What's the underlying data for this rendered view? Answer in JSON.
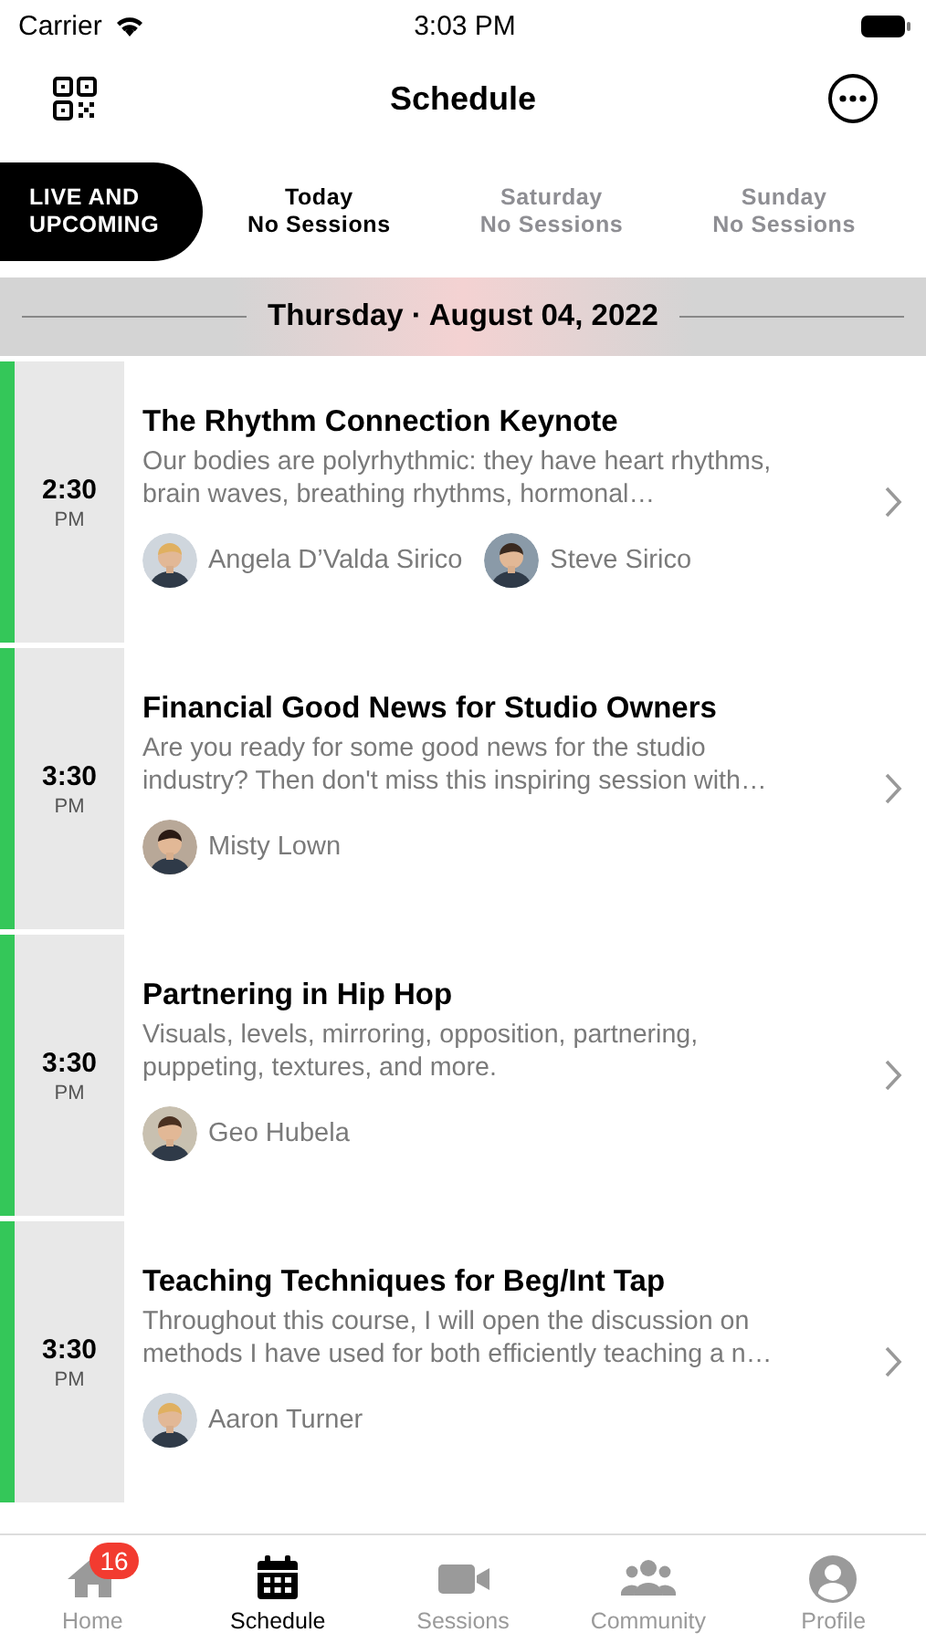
{
  "status_bar": {
    "carrier": "Carrier",
    "time": "3:03 PM"
  },
  "nav": {
    "title": "Schedule"
  },
  "day_tabs": [
    {
      "kind": "pill",
      "label": "LIVE AND UPCOMING",
      "selected": true,
      "disabled": false
    },
    {
      "kind": "day",
      "label": "Today",
      "sub": "No Sessions",
      "selected": false,
      "disabled": false
    },
    {
      "kind": "day",
      "label": "Saturday",
      "sub": "No Sessions",
      "selected": false,
      "disabled": true
    },
    {
      "kind": "day",
      "label": "Sunday",
      "sub": "No Sessions",
      "selected": false,
      "disabled": true
    }
  ],
  "date_header": "Thursday · August 04, 2022",
  "sessions": [
    {
      "time": "2:30",
      "period": "PM",
      "color": "#34c759",
      "title": "The Rhythm Connection Keynote",
      "description": "Our bodies are polyrhythmic: they have heart rhythms, brain waves, breathing rhythms, hormonal…",
      "speakers": [
        {
          "name": "Angela D’Valda Sirico"
        },
        {
          "name": "Steve Sirico"
        }
      ]
    },
    {
      "time": "3:30",
      "period": "PM",
      "color": "#34c759",
      "title": "Financial Good News for Studio Owners",
      "description": "Are you ready for some good news for the studio industry? Then don't miss this inspiring session with…",
      "speakers": [
        {
          "name": "Misty Lown"
        }
      ]
    },
    {
      "time": "3:30",
      "period": "PM",
      "color": "#34c759",
      "title": "Partnering in Hip Hop",
      "description": "Visuals, levels, mirroring, opposition, partnering, puppeting, textures, and more.",
      "speakers": [
        {
          "name": "Geo Hubela"
        }
      ]
    },
    {
      "time": "3:30",
      "period": "PM",
      "color": "#34c759",
      "title": "Teaching Techniques for Beg/Int Tap",
      "description": "Throughout this course, I will open the discussion on methods I have used for both efficiently teaching a n…",
      "speakers": [
        {
          "name": "Aaron Turner"
        }
      ]
    }
  ],
  "tab_bar": [
    {
      "kind": "home",
      "label": "Home",
      "selected": false,
      "badge": "16"
    },
    {
      "kind": "calendar",
      "label": "Schedule",
      "selected": true
    },
    {
      "kind": "video",
      "label": "Sessions",
      "selected": false
    },
    {
      "kind": "people",
      "label": "Community",
      "selected": false
    },
    {
      "kind": "person",
      "label": "Profile",
      "selected": false
    }
  ]
}
